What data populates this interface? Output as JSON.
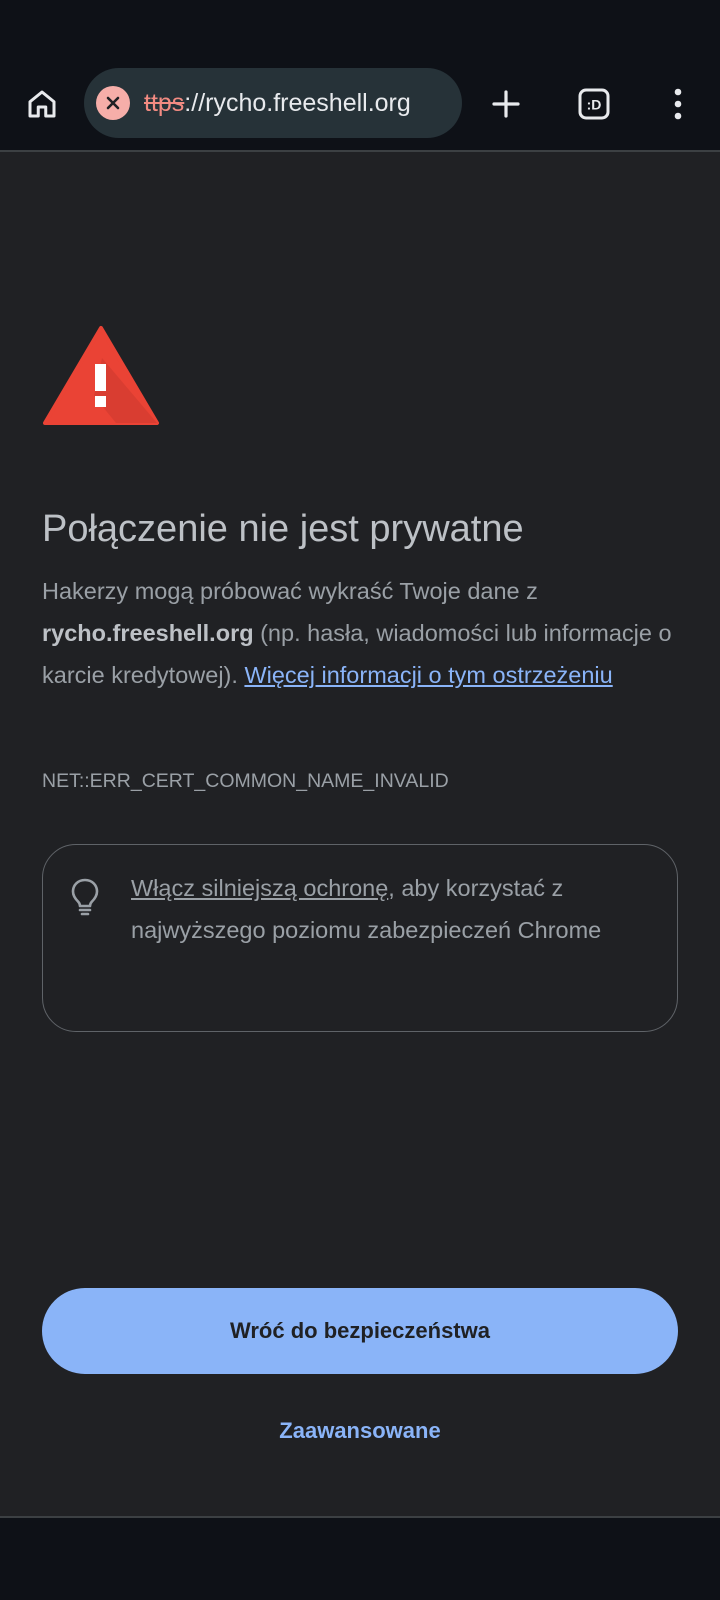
{
  "browser": {
    "url_scheme": "ttps",
    "url_rest": "://rycho.freeshell.org",
    "icons": {
      "home": "home-icon",
      "security": "not-secure-icon",
      "new_tab": "plus-icon",
      "tab_switcher": "tab-switcher-icon",
      "menu": "more-vert-icon"
    },
    "tab_switcher_label": ":D"
  },
  "interstitial": {
    "title": "Połączenie nie jest prywatne",
    "desc_part1": "Hakerzy mogą próbować wykraść Twoje dane z ",
    "desc_host": "rycho.freeshell.org",
    "desc_part2": " (np. hasła, wiadomości lub informacje o karcie kredytowej). ",
    "learn_more": "Więcej informacji o tym ostrzeżeniu",
    "error_code": "NET::ERR_CERT_COMMON_NAME_INVALID",
    "tip_link": "Włącz silniejszą ochronę",
    "tip_text": ", aby korzystać z najwyższego poziomu zabezpieczeń Chrome",
    "back_button": "Wróć do bezpieczeństwa",
    "advanced_link": "Zaawansowane"
  },
  "colors": {
    "background": "#202124",
    "accent": "#8ab4f8",
    "warning_red": "#ea4335"
  }
}
